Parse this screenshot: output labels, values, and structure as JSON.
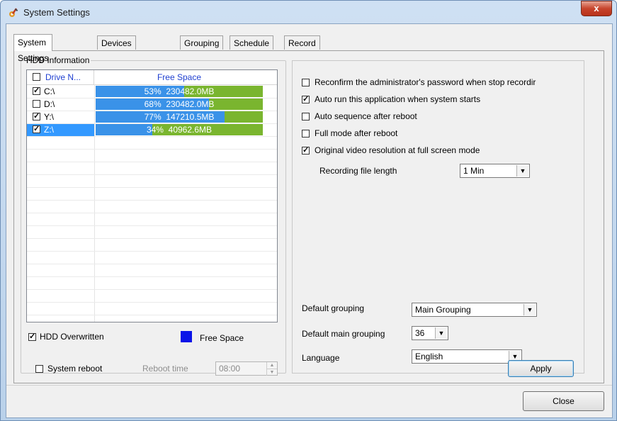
{
  "window": {
    "title": "System Settings",
    "close_glyph": "x"
  },
  "tabs": [
    {
      "label": "System Settings",
      "active": true
    },
    {
      "label": "Devices Settings",
      "active": false
    },
    {
      "label": "Grouping",
      "active": false
    },
    {
      "label": "Schedule",
      "active": false
    },
    {
      "label": "Record Time",
      "active": false
    }
  ],
  "hdd": {
    "group_title": "HDD Information",
    "columns": [
      "Drive N...",
      "Free Space"
    ],
    "drives": [
      {
        "name": "C:\\",
        "checked": true,
        "percent": 53,
        "percent_label": "53%",
        "free": "230482.0MB",
        "selected": false
      },
      {
        "name": "D:\\",
        "checked": false,
        "percent": 68,
        "percent_label": "68%",
        "free": "230482.0MB",
        "selected": false
      },
      {
        "name": "Y:\\",
        "checked": true,
        "percent": 77,
        "percent_label": "77%",
        "free": "147210.5MB",
        "selected": false
      },
      {
        "name": "Z:\\",
        "checked": true,
        "percent": 34,
        "percent_label": "34%",
        "free": "40962.6MB",
        "selected": true
      }
    ],
    "overwritten_label": "HDD Overwritten",
    "overwritten_checked": true,
    "legend_label": "Free Space",
    "colors": {
      "free": "#3a92e8",
      "used": "#7ab52f",
      "legend": "#0a14e8"
    }
  },
  "options": [
    {
      "label": "Reconfirm the administrator's password when stop recordir",
      "checked": false
    },
    {
      "label": "Auto run this application when system starts",
      "checked": true
    },
    {
      "label": "Auto sequence after reboot",
      "checked": false
    },
    {
      "label": "Full mode after reboot",
      "checked": false
    },
    {
      "label": "Original video resolution at full screen mode",
      "checked": true
    }
  ],
  "recording_file_length": {
    "label": "Recording file length",
    "value": "1 Min"
  },
  "default_grouping": {
    "label": "Default grouping",
    "value": "Main Grouping"
  },
  "default_main_grouping": {
    "label": "Default main grouping",
    "value": "36"
  },
  "language": {
    "label": "Language",
    "value": "English"
  },
  "system_reboot": {
    "label": "System reboot",
    "checked": false,
    "time_label": "Reboot time",
    "time_value": "08:00"
  },
  "buttons": {
    "apply": "Apply",
    "close": "Close"
  }
}
